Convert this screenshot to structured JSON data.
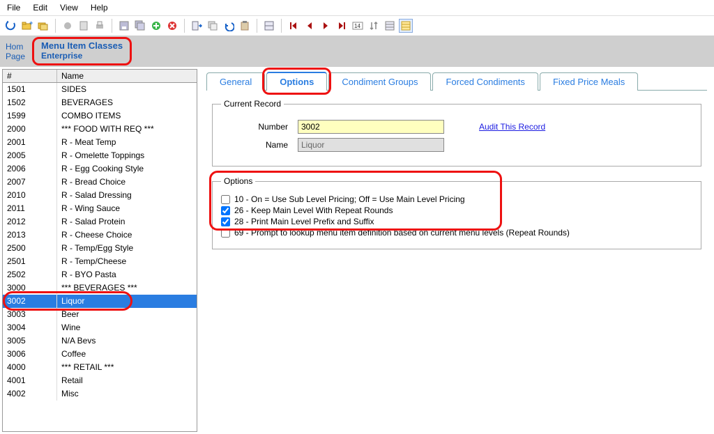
{
  "menu": {
    "file": "File",
    "edit": "Edit",
    "view": "View",
    "help": "Help"
  },
  "breadcrumb": {
    "home": "Hom",
    "page": "Page",
    "title": "Menu Item Classes",
    "scope": "Enterprise"
  },
  "grid": {
    "headers": {
      "num": "#",
      "name": "Name"
    },
    "rows": [
      {
        "num": "1501",
        "name": "SIDES"
      },
      {
        "num": "1502",
        "name": "BEVERAGES"
      },
      {
        "num": "1599",
        "name": "COMBO ITEMS"
      },
      {
        "num": "2000",
        "name": "*** FOOD WITH REQ ***"
      },
      {
        "num": "2001",
        "name": "R - Meat Temp"
      },
      {
        "num": "2005",
        "name": "R - Omelette Toppings"
      },
      {
        "num": "2006",
        "name": "R - Egg Cooking Style"
      },
      {
        "num": "2007",
        "name": "R - Bread Choice"
      },
      {
        "num": "2010",
        "name": "R - Salad Dressing"
      },
      {
        "num": "2011",
        "name": "R - Wing Sauce"
      },
      {
        "num": "2012",
        "name": "R - Salad Protein"
      },
      {
        "num": "2013",
        "name": "R - Cheese Choice"
      },
      {
        "num": "2500",
        "name": "R - Temp/Egg Style"
      },
      {
        "num": "2501",
        "name": "R - Temp/Cheese"
      },
      {
        "num": "2502",
        "name": "R - BYO Pasta"
      },
      {
        "num": "3000",
        "name": "*** BEVERAGES ***"
      },
      {
        "num": "3002",
        "name": "Liquor"
      },
      {
        "num": "3003",
        "name": "Beer"
      },
      {
        "num": "3004",
        "name": "Wine"
      },
      {
        "num": "3005",
        "name": "N/A Bevs"
      },
      {
        "num": "3006",
        "name": "Coffee"
      },
      {
        "num": "4000",
        "name": "*** RETAIL ***"
      },
      {
        "num": "4001",
        "name": "Retail"
      },
      {
        "num": "4002",
        "name": "Misc"
      }
    ],
    "selected_index": 16
  },
  "tabs": {
    "general": "General",
    "options": "Options",
    "condiment_groups": "Condiment Groups",
    "forced_condiments": "Forced Condiments",
    "fixed_price_meals": "Fixed Price Meals",
    "active": "options"
  },
  "current_record": {
    "legend": "Current Record",
    "number_label": "Number",
    "number_value": "3002",
    "name_label": "Name",
    "name_value": "Liquor",
    "audit_link": "Audit This Record"
  },
  "options_group": {
    "legend": "Options",
    "items": [
      {
        "checked": false,
        "label": "10 - On = Use Sub Level Pricing; Off = Use Main Level Pricing"
      },
      {
        "checked": true,
        "label": "26 - Keep Main Level With Repeat Rounds"
      },
      {
        "checked": true,
        "label": "28 - Print Main Level Prefix and Suffix"
      },
      {
        "checked": false,
        "label": "69 - Prompt to lookup menu item definition based on current menu levels (Repeat Rounds)"
      }
    ]
  },
  "icons": {
    "refresh": "refresh",
    "new-folder": "new-folder",
    "copy-folder": "copy-folder",
    "record": "record",
    "doc": "doc",
    "print": "print",
    "save": "save",
    "save-all": "save-all",
    "add": "add",
    "delete": "delete",
    "insert": "insert",
    "duplicate": "duplicate",
    "undo": "undo",
    "paste": "paste",
    "horiz-split": "horiz-split",
    "first": "first",
    "prev": "prev",
    "next": "next",
    "last": "last",
    "goto": "goto",
    "sort": "sort",
    "filter": "filter",
    "list-view": "list-view"
  }
}
